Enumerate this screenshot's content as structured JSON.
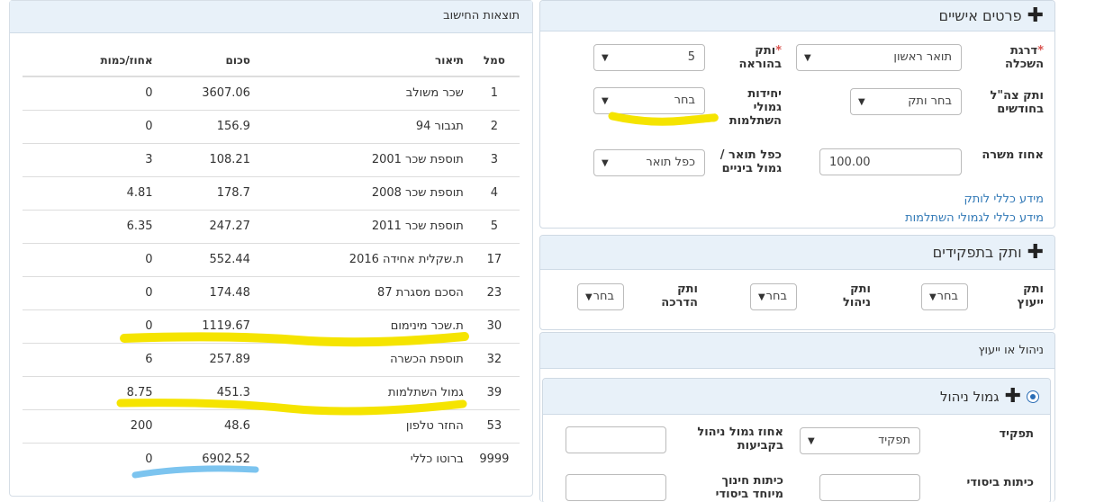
{
  "results": {
    "title": "תוצאות החישוב",
    "columns": {
      "code": "סמל",
      "desc": "תיאור",
      "sum": "סכום",
      "pct": "אחוז/כמות"
    },
    "rows": [
      {
        "code": "1",
        "desc": "שכר משולב",
        "sum": "3607.06",
        "pct": "0"
      },
      {
        "code": "2",
        "desc": "תגבור 94",
        "sum": "156.9",
        "pct": "0"
      },
      {
        "code": "3",
        "desc": "תוספת שכר 2001",
        "sum": "108.21",
        "pct": "3"
      },
      {
        "code": "4",
        "desc": "תוספת שכר 2008",
        "sum": "178.7",
        "pct": "4.81"
      },
      {
        "code": "5",
        "desc": "תוספת שכר 2011",
        "sum": "247.27",
        "pct": "6.35"
      },
      {
        "code": "17",
        "desc": "ת.שקלית אחידה 2016",
        "sum": "552.44",
        "pct": "0"
      },
      {
        "code": "23",
        "desc": "הסכם מסגרת 87",
        "sum": "174.48",
        "pct": "0"
      },
      {
        "code": "30",
        "desc": "ת.שכר מינימום",
        "sum": "1119.67",
        "pct": "0"
      },
      {
        "code": "32",
        "desc": "תוספת הכשרה",
        "sum": "257.89",
        "pct": "6"
      },
      {
        "code": "39",
        "desc": "גמול השתלמות",
        "sum": "451.3",
        "pct": "8.75"
      },
      {
        "code": "53",
        "desc": "החזר טלפון",
        "sum": "48.6",
        "pct": "200"
      },
      {
        "code": "9999",
        "desc": "ברוטו כללי",
        "sum": "6902.52",
        "pct": "0"
      }
    ]
  },
  "personal": {
    "title": "פרטים אישיים",
    "education_label": "דרגת השכלה",
    "education_value": "תואר ראשון",
    "teaching_seniority_label": "ותק בהוראה",
    "teaching_seniority_value": "5",
    "army_seniority_label": "ותק צה\"ל בחודשים",
    "army_seniority_value": "בחר ותק",
    "training_units_label": "יחידות גמולי השתלמות",
    "training_units_value": "בחר",
    "position_pct_label": "אחוז משרה",
    "position_pct_value": "100.00",
    "degree_double_label": "כפל תואר / גמול ביניים",
    "degree_double_value": "כפל תואר",
    "link_seniority": "מידע כללי לותק",
    "link_training": "מידע כללי לגמולי השתלמות"
  },
  "roles": {
    "title": "ותק בתפקידים",
    "consulting_label": "ותק ייעוץ",
    "consulting_value": "בחר",
    "management_label": "ותק ניהול",
    "management_value": "בחר",
    "guidance_label": "ותק הדרכה",
    "guidance_value": "בחר"
  },
  "management": {
    "title": "ניהול או ייעוץ",
    "sub_title": "גמול ניהול",
    "role_label": "תפקיד",
    "role_value": "תפקיד",
    "mgmt_pct_label": "אחוז גמול ניהול בקביעות",
    "basic_classes_label": "כיתות ביסודי",
    "special_ed_label": "כיתות חינוך מיוחד ביסודי"
  },
  "colors": {
    "highlight": "#f5e400",
    "blue_mark": "#7cc4ef",
    "header_bg": "#e8f1f9"
  }
}
